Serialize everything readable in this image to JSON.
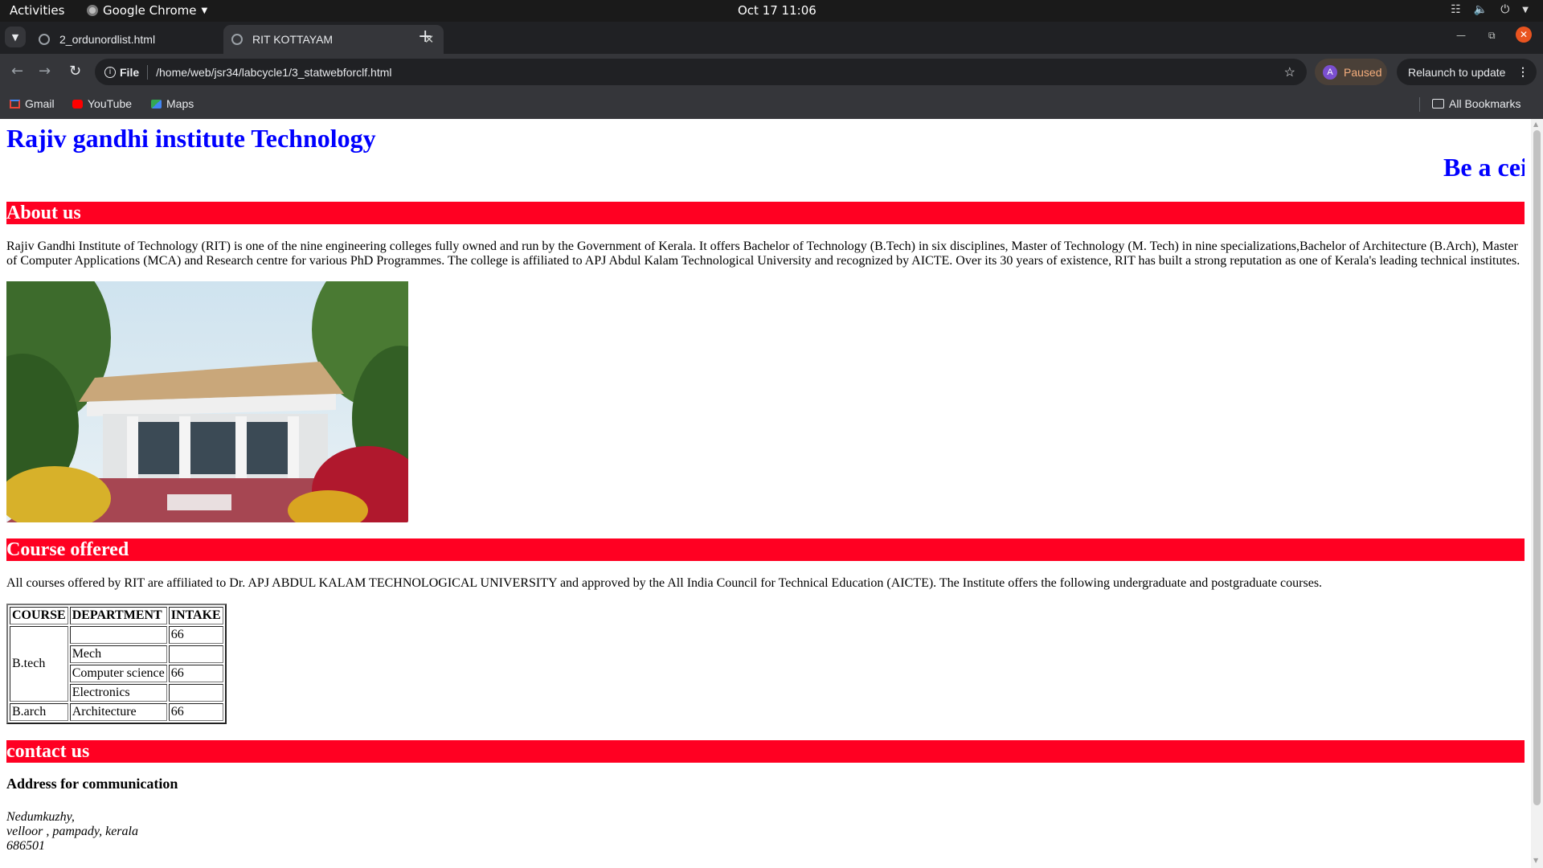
{
  "os": {
    "activities": "Activities",
    "app_name": "Google Chrome",
    "clock": "Oct 17  11:06"
  },
  "browser": {
    "tabs": [
      {
        "title": "2_ordunordlist.html",
        "active": false
      },
      {
        "title": "RIT KOTTAYAM",
        "active": true
      }
    ],
    "omnibox_chip": "File",
    "url": "/home/web/jsr34/labcycle1/3_statwebforclf.html",
    "profile_initial": "A",
    "profile_status": "Paused",
    "relaunch_label": "Relaunch to update",
    "bookmarks": [
      "Gmail",
      "YouTube",
      "Maps"
    ],
    "all_bookmarks": "All Bookmarks"
  },
  "page": {
    "site_title": "Rajiv gandhi institute Technology",
    "marquee_text": "Be a cei",
    "about": {
      "heading": "About us",
      "text": "Rajiv Gandhi Institute of Technology (RIT) is one of the nine engineering colleges fully owned and run by the Government of Kerala. It offers Bachelor of Technology (B.Tech) in six disciplines, Master of Technology (M. Tech) in nine specializations,Bachelor of Architecture (B.Arch), Master of Computer Applications (MCA) and Research centre for various PhD Programmes. The college is affiliated to APJ Abdul Kalam Technological University and recognized by AICTE. Over its 30 years of existence, RIT has built a strong reputation as one of Kerala's leading technical institutes."
    },
    "courses": {
      "heading": "Course offered",
      "text": "All courses offered by RIT are affiliated to Dr. APJ ABDUL KALAM TECHNOLOGICAL UNIVERSITY and approved by the All India Council for Technical Education (AICTE). The Institute offers the following undergraduate and postgraduate courses.",
      "table": {
        "headers": [
          "COURSE",
          "DEPARTMENT",
          "INTAKE"
        ],
        "btech_label": "B.tech",
        "btech_rows": [
          {
            "department": "",
            "intake": "66"
          },
          {
            "department": "Mech",
            "intake": ""
          },
          {
            "department": "Computer science",
            "intake": "66"
          },
          {
            "department": "Electronics",
            "intake": ""
          }
        ],
        "barch_row": {
          "course": "B.arch",
          "department": "Architecture",
          "intake": "66"
        }
      }
    },
    "contact": {
      "heading": "contact us",
      "address_heading": "Address for communication",
      "address_lines": [
        "Nedumkuzhy,",
        "velloor , pampady, kerala",
        "686501"
      ]
    }
  }
}
